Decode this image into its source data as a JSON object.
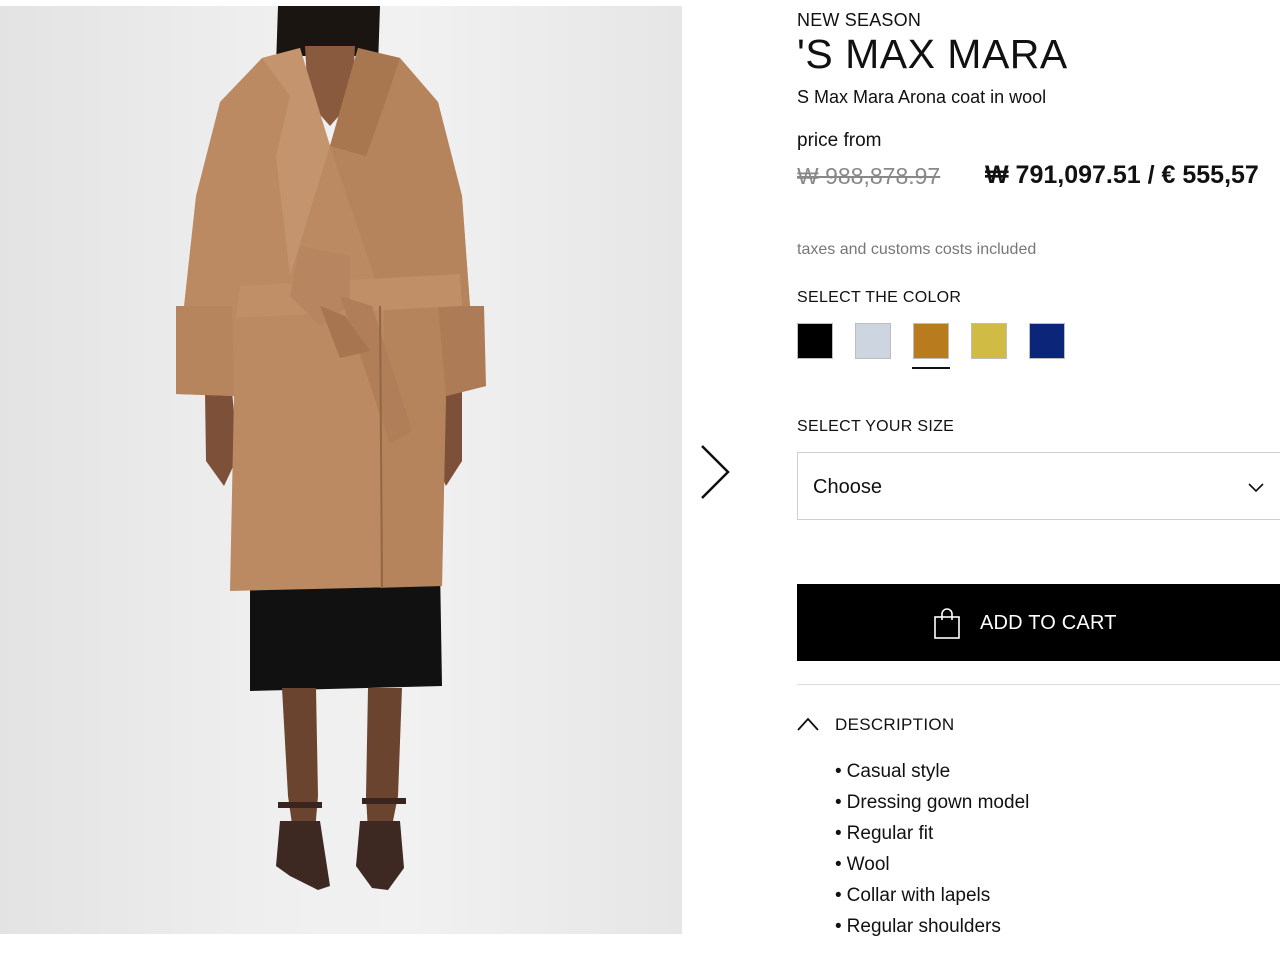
{
  "product": {
    "badge": "NEW SEASON",
    "brand": "'S MAX MARA",
    "name": "S Max Mara Arona coat in wool",
    "image_alt": "Model wearing camel belted wool coat"
  },
  "pricing": {
    "label": "price from",
    "original_price": "₩ 988,878.97",
    "sale_price": "₩ 791,097.51 / € 555,57",
    "tax_note": "taxes and customs costs included"
  },
  "color_selector": {
    "label": "SELECT THE COLOR",
    "swatches": [
      {
        "color": "#000000",
        "selected": false
      },
      {
        "color": "#cdd6e0",
        "selected": false
      },
      {
        "color": "#b87c1e",
        "selected": true
      },
      {
        "color": "#d0bb45",
        "selected": false
      },
      {
        "color": "#0b2578",
        "selected": false
      }
    ]
  },
  "size_selector": {
    "label": "SELECT YOUR SIZE",
    "value": "Choose",
    "icon": "chevron-down-icon"
  },
  "cart": {
    "label": "ADD TO CART",
    "icon": "shopping-bag-icon"
  },
  "gallery": {
    "next_icon": "chevron-right-icon"
  },
  "description": {
    "label": "DESCRIPTION",
    "icon": "chevron-up-icon",
    "items": [
      "Casual style",
      "Dressing gown model",
      "Regular fit",
      "Wool",
      "Collar with lapels",
      "Regular shoulders"
    ]
  }
}
